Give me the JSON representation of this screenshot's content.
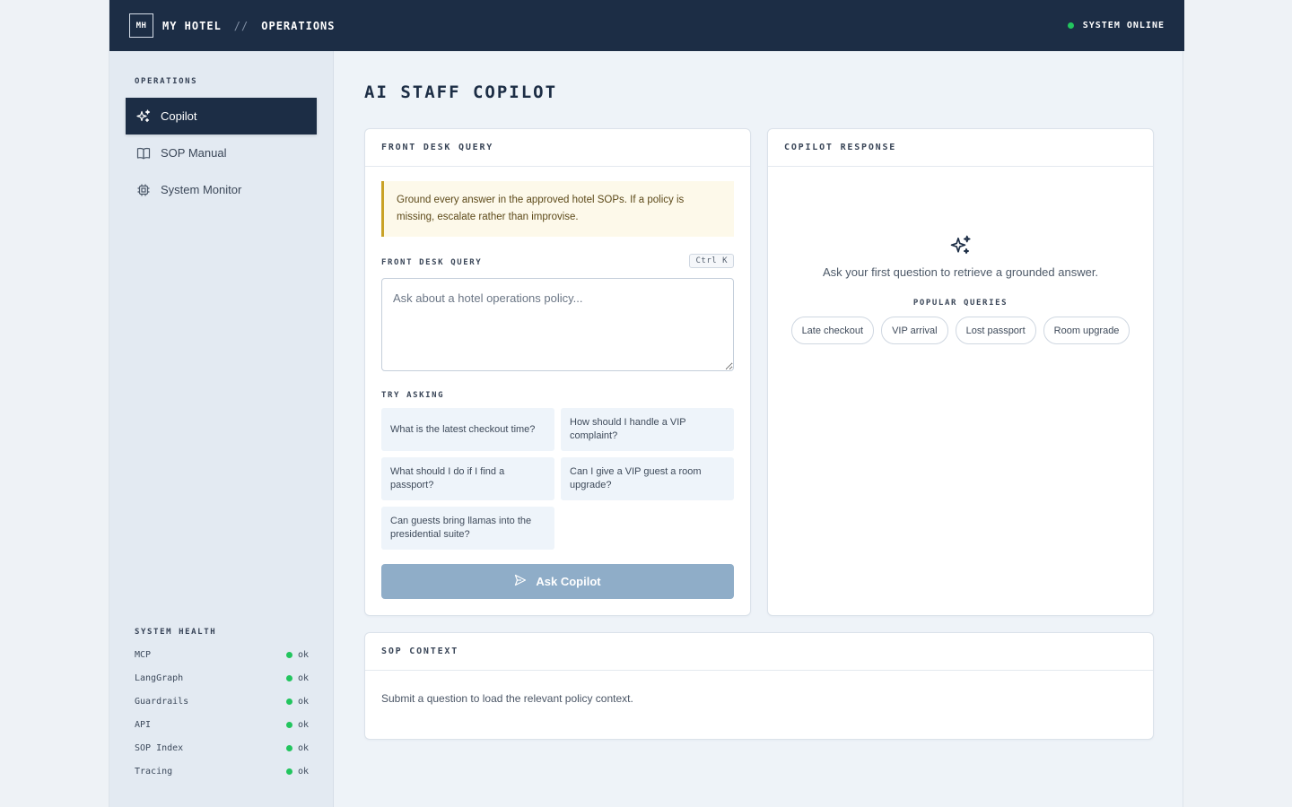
{
  "topbar": {
    "logo": "MH",
    "brand": "MY HOTEL",
    "separator": "//",
    "section": "OPERATIONS",
    "status": "SYSTEM ONLINE",
    "status_color": "#22c55e"
  },
  "sidebar": {
    "heading": "OPERATIONS",
    "items": [
      {
        "label": "Copilot",
        "icon": "sparkles-icon",
        "active": true
      },
      {
        "label": "SOP Manual",
        "icon": "book-icon",
        "active": false
      },
      {
        "label": "System Monitor",
        "icon": "cpu-chip-icon",
        "active": false
      }
    ],
    "health_heading": "SYSTEM HEALTH",
    "health": [
      {
        "name": "MCP",
        "status": "ok"
      },
      {
        "name": "LangGraph",
        "status": "ok"
      },
      {
        "name": "Guardrails",
        "status": "ok"
      },
      {
        "name": "API",
        "status": "ok"
      },
      {
        "name": "SOP Index",
        "status": "ok"
      },
      {
        "name": "Tracing",
        "status": "ok"
      }
    ]
  },
  "main": {
    "title": "AI STAFF COPILOT",
    "query_card": {
      "header": "FRONT DESK QUERY",
      "notice": "Ground every answer in the approved hotel SOPs. If a policy is missing, escalate rather than improvise.",
      "field_label": "FRONT DESK QUERY",
      "shortcut": "Ctrl K",
      "placeholder": "Ask about a hotel operations policy...",
      "value": "",
      "try_label": "TRY ASKING",
      "suggestions": [
        "What is the latest checkout time?",
        "How should I handle a VIP complaint?",
        "What should I do if I find a passport?",
        "Can I give a VIP guest a room upgrade?",
        "Can guests bring llamas into the presidential suite?"
      ],
      "ask_button": "Ask Copilot"
    },
    "response_card": {
      "header": "COPILOT RESPONSE",
      "empty_text": "Ask your first question to retrieve a grounded answer.",
      "popular_label": "POPULAR QUERIES",
      "popular": [
        "Late checkout",
        "VIP arrival",
        "Lost passport",
        "Room upgrade"
      ]
    },
    "context_card": {
      "header": "SOP CONTEXT",
      "text": "Submit a question to load the relevant policy context."
    }
  },
  "colors": {
    "navy": "#1c2d45",
    "accent_button": "#8fadc8",
    "notice_border": "#c9a227",
    "ok_green": "#22c55e"
  }
}
